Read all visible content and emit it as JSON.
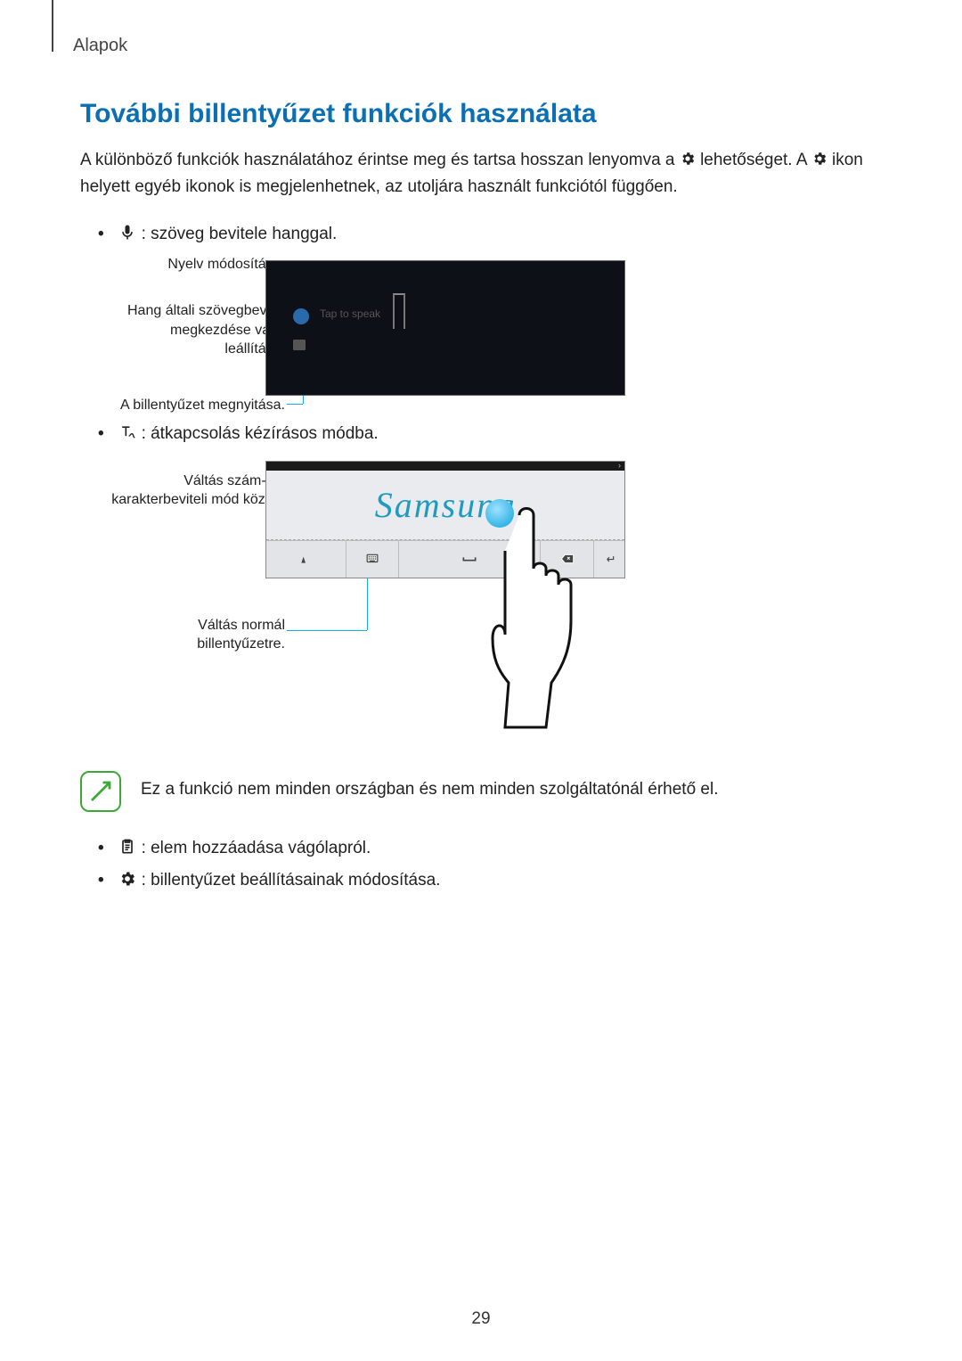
{
  "header": "Alapok",
  "section_title": "További billentyűzet funkciók használata",
  "intro_part1": "A különböző funkciók használatához érintse meg és tartsa hosszan lenyomva a ",
  "intro_part2": " lehetőséget. A ",
  "intro_part3": " ikon helyett egyéb ikonok is megjelenhetnek, az utoljára használt funkciótól függően.",
  "bullets": {
    "voice": " : szöveg bevitele hanggal.",
    "hand": " : átkapcsolás kézírásos módba.",
    "clip": " : elem hozzáadása vágólapról.",
    "gear": " : billentyűzet beállításainak módosítása."
  },
  "fig1": {
    "l1": "Nyelv módosítása.",
    "l2": "Hang általi szövegbevitel megkezdése vagy leállítása.",
    "l3": "A billentyűzet megnyitása.",
    "tap": "Tap to speak"
  },
  "fig2": {
    "l1": "Váltás szám- és karakterbeviteli mód között.",
    "l2": "Váltás normál billentyűzetre.",
    "writing": "Samsung",
    "chev": "›"
  },
  "note": "Ez a funkció nem minden országban és nem minden szolgáltatónál érhető el.",
  "page_number": "29"
}
